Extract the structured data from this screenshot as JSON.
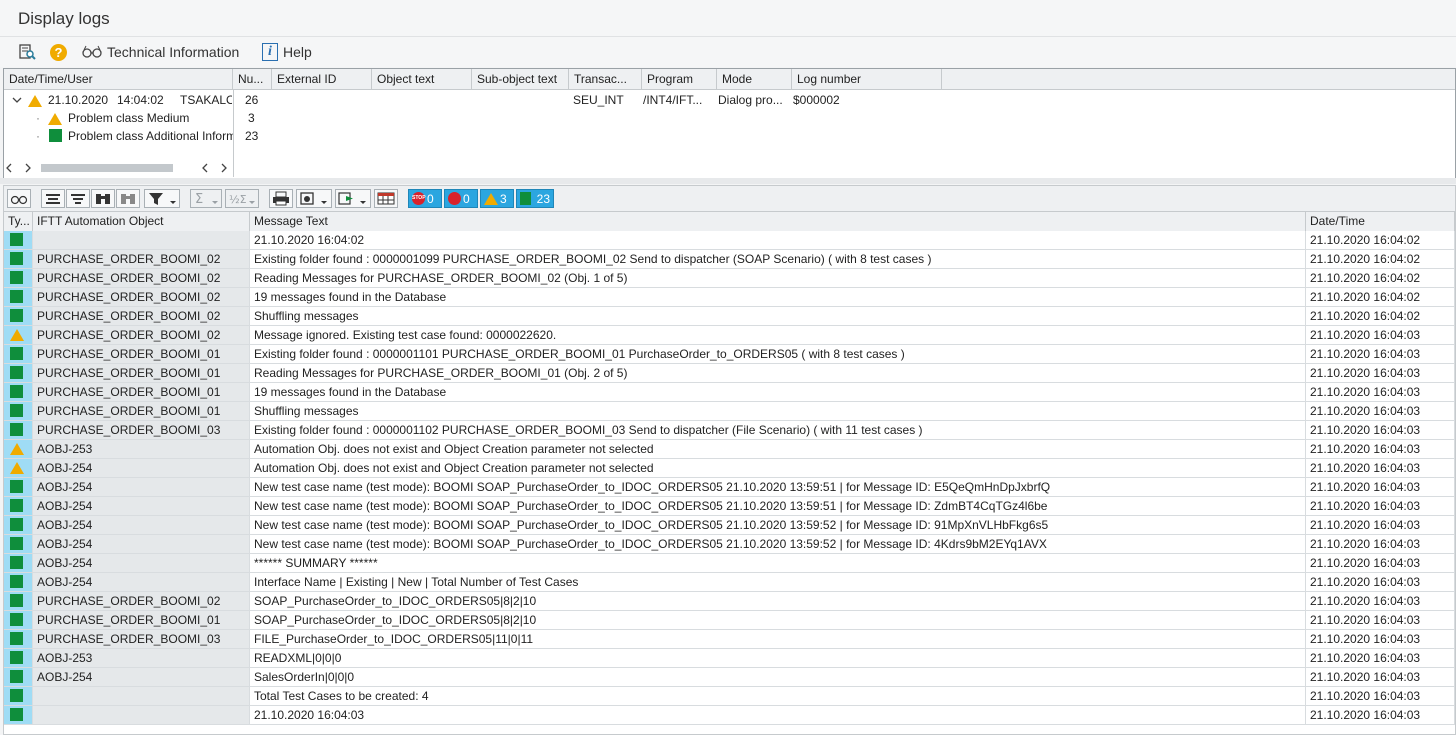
{
  "window": {
    "title": "Display logs"
  },
  "toolbar": {
    "tech_info": "Technical Information",
    "help": "Help"
  },
  "tree": {
    "columns": [
      "Date/Time/User",
      "Nu...",
      "External ID",
      "Object text",
      "Sub-object text",
      "Transac...",
      "Program",
      "Mode",
      "Log number"
    ],
    "root": {
      "date": "21.10.2020",
      "time": "14:04:02",
      "user": "TSAKALO",
      "num": "26",
      "transaction": "SEU_INT",
      "program": "/INT4/IFT...",
      "mode": "Dialog pro...",
      "log_number": "$000002"
    },
    "children": [
      {
        "label": "Problem class Medium",
        "num": "3",
        "icon": "warning"
      },
      {
        "label": "Problem class Additional Inform",
        "num": "23",
        "icon": "success"
      }
    ]
  },
  "counters": {
    "stop": "0",
    "error": "0",
    "warning": "3",
    "success": "23"
  },
  "grid": {
    "columns": [
      "Ty...",
      "IFTT Automation Object",
      "Message Text",
      "Date/Time"
    ],
    "rows": [
      {
        "t": "s",
        "obj": "",
        "msg": "21.10.2020 16:04:02",
        "dt": "21.10.2020 16:04:02"
      },
      {
        "t": "s",
        "obj": "PURCHASE_ORDER_BOOMI_02",
        "msg": "Existing folder found : 0000001099 PURCHASE_ORDER_BOOMI_02 Send to dispatcher (SOAP Scenario) ( with 8 test cases )",
        "dt": "21.10.2020 16:04:02"
      },
      {
        "t": "s",
        "obj": "PURCHASE_ORDER_BOOMI_02",
        "msg": "Reading Messages for PURCHASE_ORDER_BOOMI_02 (Obj. 1 of 5)",
        "dt": "21.10.2020 16:04:02"
      },
      {
        "t": "s",
        "obj": "PURCHASE_ORDER_BOOMI_02",
        "msg": "19 messages found in the Database",
        "dt": "21.10.2020 16:04:02"
      },
      {
        "t": "s",
        "obj": "PURCHASE_ORDER_BOOMI_02",
        "msg": "Shuffling messages",
        "dt": "21.10.2020 16:04:02"
      },
      {
        "t": "w",
        "obj": "PURCHASE_ORDER_BOOMI_02",
        "msg": "Message ignored. Existing test case found: 0000022620.",
        "dt": "21.10.2020 16:04:03"
      },
      {
        "t": "s",
        "obj": "PURCHASE_ORDER_BOOMI_01",
        "msg": "Existing folder found : 0000001101 PURCHASE_ORDER_BOOMI_01 PurchaseOrder_to_ORDERS05 ( with 8 test cases )",
        "dt": "21.10.2020 16:04:03"
      },
      {
        "t": "s",
        "obj": "PURCHASE_ORDER_BOOMI_01",
        "msg": "Reading Messages for PURCHASE_ORDER_BOOMI_01 (Obj. 2 of 5)",
        "dt": "21.10.2020 16:04:03"
      },
      {
        "t": "s",
        "obj": "PURCHASE_ORDER_BOOMI_01",
        "msg": "19 messages found in the Database",
        "dt": "21.10.2020 16:04:03"
      },
      {
        "t": "s",
        "obj": "PURCHASE_ORDER_BOOMI_01",
        "msg": "Shuffling messages",
        "dt": "21.10.2020 16:04:03"
      },
      {
        "t": "s",
        "obj": "PURCHASE_ORDER_BOOMI_03",
        "msg": "Existing folder found : 0000001102 PURCHASE_ORDER_BOOMI_03 Send to dispatcher (File Scenario) ( with 11 test cases )",
        "dt": "21.10.2020 16:04:03"
      },
      {
        "t": "w",
        "obj": "AOBJ-253",
        "msg": "Automation Obj. does not exist and Object Creation parameter not selected",
        "dt": "21.10.2020 16:04:03"
      },
      {
        "t": "w",
        "obj": "AOBJ-254",
        "msg": "Automation Obj. does not exist and Object Creation parameter not selected",
        "dt": "21.10.2020 16:04:03"
      },
      {
        "t": "s",
        "obj": "AOBJ-254",
        "msg": "New test case name (test mode): BOOMI SOAP_PurchaseOrder_to_IDOC_ORDERS05 21.10.2020 13:59:51 | for Message ID: E5QeQmHnDpJxbrfQ",
        "dt": "21.10.2020 16:04:03"
      },
      {
        "t": "s",
        "obj": "AOBJ-254",
        "msg": "New test case name (test mode): BOOMI SOAP_PurchaseOrder_to_IDOC_ORDERS05 21.10.2020 13:59:51 | for Message ID: ZdmBT4CqTGz4l6be",
        "dt": "21.10.2020 16:04:03"
      },
      {
        "t": "s",
        "obj": "AOBJ-254",
        "msg": "New test case name (test mode): BOOMI SOAP_PurchaseOrder_to_IDOC_ORDERS05 21.10.2020 13:59:52 | for Message ID: 91MpXnVLHbFkg6s5",
        "dt": "21.10.2020 16:04:03"
      },
      {
        "t": "s",
        "obj": "AOBJ-254",
        "msg": "New test case name (test mode): BOOMI SOAP_PurchaseOrder_to_IDOC_ORDERS05 21.10.2020 13:59:52 | for Message ID: 4Kdrs9bM2EYq1AVX",
        "dt": "21.10.2020 16:04:03"
      },
      {
        "t": "s",
        "obj": "AOBJ-254",
        "msg": "****** SUMMARY ******",
        "dt": "21.10.2020 16:04:03"
      },
      {
        "t": "s",
        "obj": "AOBJ-254",
        "msg": "Interface Name | Existing | New | Total Number of Test Cases",
        "dt": "21.10.2020 16:04:03"
      },
      {
        "t": "s",
        "obj": "PURCHASE_ORDER_BOOMI_02",
        "msg": "SOAP_PurchaseOrder_to_IDOC_ORDERS05|8|2|10",
        "dt": "21.10.2020 16:04:03"
      },
      {
        "t": "s",
        "obj": "PURCHASE_ORDER_BOOMI_01",
        "msg": "SOAP_PurchaseOrder_to_IDOC_ORDERS05|8|2|10",
        "dt": "21.10.2020 16:04:03"
      },
      {
        "t": "s",
        "obj": "PURCHASE_ORDER_BOOMI_03",
        "msg": "FILE_PurchaseOrder_to_IDOC_ORDERS05|11|0|11",
        "dt": "21.10.2020 16:04:03"
      },
      {
        "t": "s",
        "obj": "AOBJ-253",
        "msg": "READXML|0|0|0",
        "dt": "21.10.2020 16:04:03"
      },
      {
        "t": "s",
        "obj": "AOBJ-254",
        "msg": "SalesOrderIn|0|0|0",
        "dt": "21.10.2020 16:04:03"
      },
      {
        "t": "s",
        "obj": "",
        "msg": "Total Test Cases to be created: 4",
        "dt": "21.10.2020 16:04:03"
      },
      {
        "t": "s",
        "obj": "",
        "msg": "21.10.2020 16:04:03",
        "dt": "21.10.2020 16:04:03"
      }
    ]
  },
  "colors": {
    "success": "#0f8e3c",
    "warning": "#f0ab00",
    "counter_bg": "#2ba6e0",
    "type_col": "#9fdcf5"
  }
}
